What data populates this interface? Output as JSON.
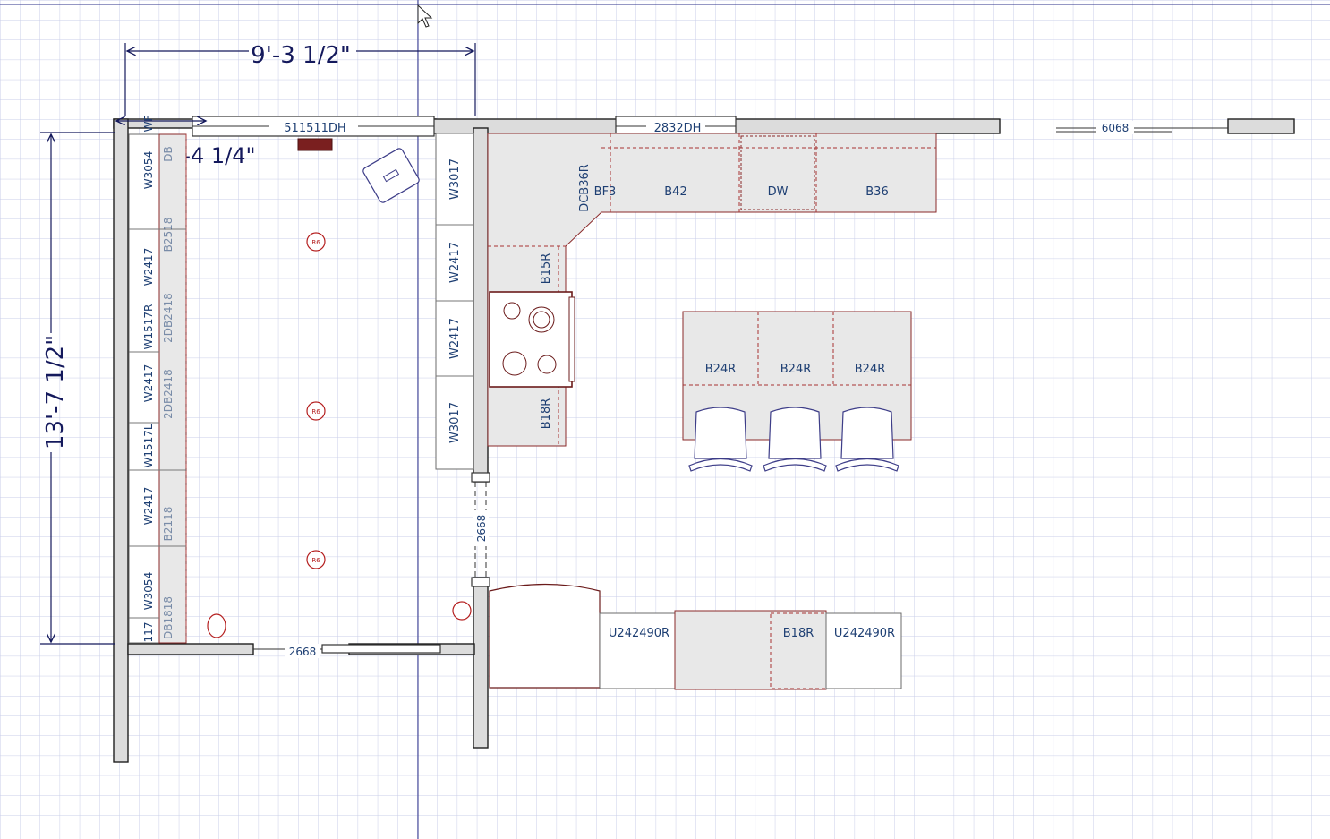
{
  "dimensions": {
    "top_width": "9'-3 1/2\"",
    "inner_offset": "2'-4 1/4\"",
    "left_height": "13'-7 1/2\""
  },
  "windows": {
    "left": "511511DH",
    "right": "2832DH",
    "far": "6068"
  },
  "doors": {
    "side": "2668",
    "bottom": "2668"
  },
  "left_wall_cabinets": [
    {
      "label": "W3054",
      "extra": "WF"
    },
    {
      "label": "W2417"
    },
    {
      "label": "W1517R"
    },
    {
      "label": "W2417"
    },
    {
      "label": "W1517L"
    },
    {
      "label": "W2417"
    },
    {
      "label": "W3054"
    },
    {
      "label": "117"
    }
  ],
  "left_base_cabinets": [
    "DB",
    "B2518",
    "2DB2418",
    "2DB2418",
    "B2118",
    "DB1818"
  ],
  "center_wall_cabinets": [
    "W3017",
    "W2417",
    "W2417",
    "W3017"
  ],
  "kitchen": {
    "corner": "DCB36R",
    "filler": "BF3",
    "base_42": "B42",
    "dishwasher": "DW",
    "base_36": "B36",
    "base_15": "B15R",
    "base_18": "B18R"
  },
  "island": {
    "cabinets": [
      "B24R",
      "B24R",
      "B24R"
    ],
    "chairs": 3
  },
  "lower_run": {
    "left": "U242490R",
    "middle": "B18R",
    "right": "U242490R"
  },
  "light_label": "R6",
  "colors": {
    "grid": "#c6cbe6",
    "dimension": "#14195c",
    "label": "#1e3f73",
    "cabinet_outline": "#8a2a2a",
    "wall": "#1f1f1f"
  }
}
